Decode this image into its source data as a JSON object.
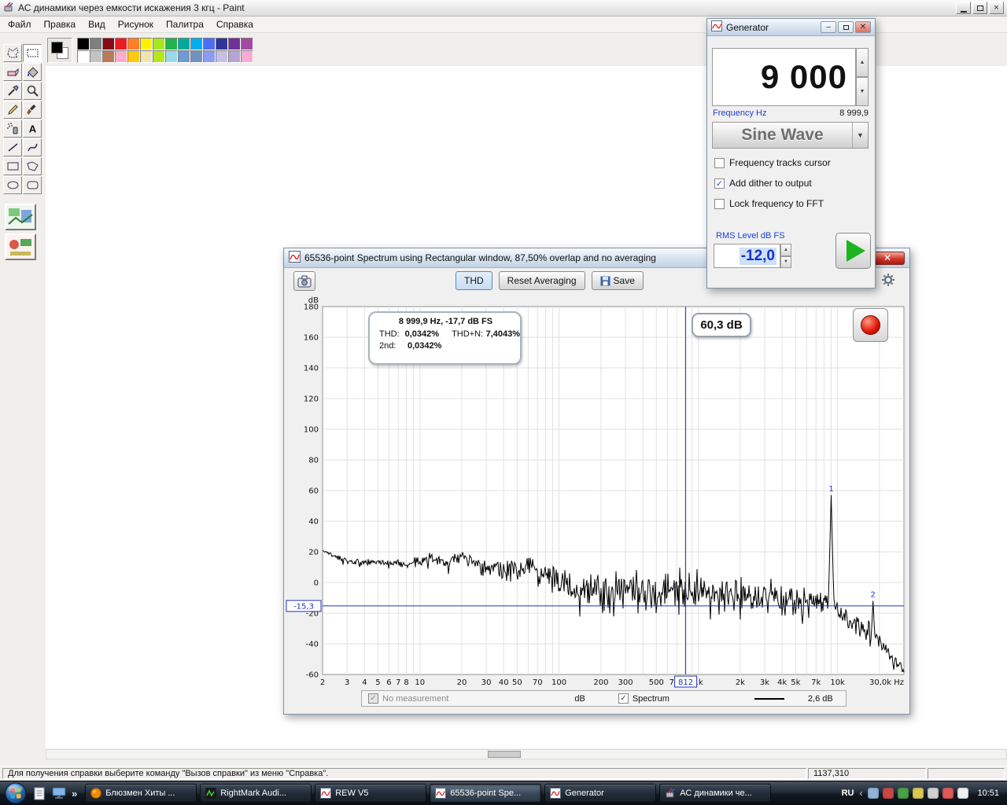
{
  "paint": {
    "title": "АС динамики через емкости искажения 3 кгц - Paint",
    "menus": [
      "Файл",
      "Правка",
      "Вид",
      "Рисунок",
      "Палитра",
      "Справка"
    ],
    "tools": [
      "free-select",
      "rect-select",
      "eraser",
      "fill",
      "picker",
      "magnifier",
      "pencil",
      "brush",
      "airbrush",
      "text",
      "line",
      "curve",
      "rectangle",
      "polygon",
      "ellipse",
      "rounded-rect"
    ],
    "selected_tool": "rect-select",
    "palette_row1": [
      "#000000",
      "#7f7f7f",
      "#870a15",
      "#ec1c24",
      "#ff7f27",
      "#fff200",
      "#a8e61d",
      "#22b14c",
      "#00a99d",
      "#00aeef",
      "#4d6df3",
      "#2f3699",
      "#6f3198",
      "#a349a4"
    ],
    "palette_row2": [
      "#ffffff",
      "#c3c3c3",
      "#b97a57",
      "#ffaec9",
      "#ffc90e",
      "#efe4b0",
      "#b5e61d",
      "#99d9ea",
      "#709ad1",
      "#7092be",
      "#8b9bf3",
      "#c8bfe7",
      "#b5a5d5",
      "#ffaad5"
    ],
    "status_text": "Для получения справки выберите команду \"Вызов справки\" из меню \"Справка\".",
    "status_coords": "1137,310"
  },
  "spectrum": {
    "title": "65536-point Spectrum using Rectangular window, 87,50% overlap and no averaging",
    "toolbar": {
      "thd": "THD",
      "reset": "Reset Averaging",
      "save": "Save"
    },
    "info_header": "8 999,9 Hz,  -17,7 dB FS",
    "thd_label": "THD:",
    "thd_value": "0,0342%",
    "thdn_label": "THD+N:",
    "thdn_value": "7,4043%",
    "h2_label": "2nd:",
    "h2_value": "0,0342%",
    "level_badge": "60,3 dB",
    "legend": {
      "no_measurement": "No measurement",
      "db_label": "dB",
      "spectrum_label": "Spectrum",
      "value": "2,6 dB"
    }
  },
  "generator": {
    "title": "Generator",
    "freq_display": "9 000",
    "freq_label": "Frequency Hz",
    "freq_readout": "8 999,9",
    "waveform": "Sine Wave",
    "options": [
      {
        "label": "Frequency tracks cursor",
        "checked": false
      },
      {
        "label": "Add dither to output",
        "checked": true
      },
      {
        "label": "Lock frequency to FFT",
        "checked": false
      }
    ],
    "rms_label": "RMS Level dB FS",
    "rms_value": "-12,0"
  },
  "taskbar": {
    "tasks": [
      {
        "label": "Блюзмен Хиты ...",
        "icon": "music",
        "active": false
      },
      {
        "label": "RightMark Audi...",
        "icon": "rmaa",
        "active": false
      },
      {
        "label": "REW V5",
        "icon": "rew",
        "active": false
      },
      {
        "label": "65536-point Spe...",
        "icon": "rew",
        "active": true
      },
      {
        "label": "Generator",
        "icon": "rew",
        "active": false
      },
      {
        "label": "АС динамики че...",
        "icon": "paint",
        "active": false
      }
    ],
    "language": "RU",
    "clock": "10:51",
    "tray_colors": [
      "#8fb4d8",
      "#c84848",
      "#48a048",
      "#d8c850",
      "#d0d0d0",
      "#e05858",
      "#f0f0f0"
    ]
  },
  "chart_data": {
    "type": "line",
    "title": "65536-point Spectrum using Rectangular window, 87,50% overlap and no averaging",
    "ylabel": "dB",
    "ylim": [
      -60,
      180
    ],
    "y_ticks": [
      180,
      160,
      140,
      120,
      100,
      80,
      60,
      40,
      20,
      0,
      -20,
      -40,
      -60
    ],
    "x_scale": "log",
    "xlim": [
      2,
      30000
    ],
    "x_unit": "Hz",
    "x_tick_labels": [
      [
        2,
        "2"
      ],
      [
        3,
        "3"
      ],
      [
        4,
        "4"
      ],
      [
        5,
        "5"
      ],
      [
        6,
        "6"
      ],
      [
        7,
        "7"
      ],
      [
        8,
        "8"
      ],
      [
        10,
        "10"
      ],
      [
        20,
        "20"
      ],
      [
        30,
        "30"
      ],
      [
        40,
        "40"
      ],
      [
        50,
        "50"
      ],
      [
        70,
        "70"
      ],
      [
        100,
        "100"
      ],
      [
        200,
        "200"
      ],
      [
        300,
        "300"
      ],
      [
        500,
        "500"
      ],
      [
        700,
        "700"
      ],
      [
        1000,
        "1k"
      ],
      [
        2000,
        "2k"
      ],
      [
        3000,
        "3k"
      ],
      [
        4000,
        "4k"
      ],
      [
        5000,
        "5k"
      ],
      [
        7000,
        "7k"
      ],
      [
        10000,
        "10k"
      ],
      [
        30000,
        "30,0k"
      ]
    ],
    "cursor": {
      "freq": 812,
      "freq_label": "812",
      "db": -15.3,
      "db_label": "-15,3"
    },
    "peaks": [
      {
        "n": "1",
        "freq": 9000,
        "db": 57,
        "hw": 0.02
      },
      {
        "n": "2",
        "freq": 18000,
        "db": -12,
        "hw": 0.012
      }
    ],
    "envelope": [
      [
        2,
        21,
        1
      ],
      [
        2.6,
        16,
        1.5
      ],
      [
        3,
        13.5,
        2
      ],
      [
        4,
        13,
        2
      ],
      [
        5,
        14,
        2
      ],
      [
        6,
        13,
        2
      ],
      [
        7,
        12.5,
        2
      ],
      [
        8,
        12,
        2.5
      ],
      [
        10,
        14.5,
        3
      ],
      [
        13,
        16,
        4
      ],
      [
        16,
        13,
        4
      ],
      [
        20,
        18,
        4
      ],
      [
        24,
        13,
        5
      ],
      [
        30,
        10,
        6
      ],
      [
        40,
        8,
        7
      ],
      [
        50,
        9,
        8
      ],
      [
        60,
        12,
        9
      ],
      [
        80,
        5,
        9
      ],
      [
        100,
        0,
        9
      ],
      [
        150,
        -4,
        10
      ],
      [
        200,
        -5,
        11
      ],
      [
        300,
        -6,
        12
      ],
      [
        500,
        -6,
        12
      ],
      [
        800,
        -5,
        12
      ],
      [
        1000,
        -6,
        12
      ],
      [
        2000,
        -8,
        11
      ],
      [
        3000,
        -10,
        10
      ],
      [
        5000,
        -12,
        9
      ],
      [
        7000,
        -13,
        8
      ],
      [
        8500,
        -14,
        6
      ],
      [
        9600,
        -16,
        5
      ],
      [
        11000,
        -22,
        6
      ],
      [
        13000,
        -26,
        6
      ],
      [
        16000,
        -30,
        6
      ],
      [
        20000,
        -38,
        6
      ],
      [
        25000,
        -50,
        4
      ],
      [
        30000,
        -58,
        3
      ]
    ],
    "signal": {
      "frequency_hz": "8 999,9",
      "level_dbfs": "-17,7",
      "thd_pct": "0,0342",
      "thdn_pct": "7,4043",
      "h2_pct": "0,0342",
      "rms_db": "60,3"
    }
  }
}
